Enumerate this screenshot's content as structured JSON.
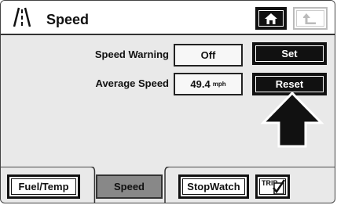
{
  "header": {
    "title": "Speed",
    "app_icon": "road-icon",
    "home_icon": "home-icon",
    "back_icon": "back-arrow-icon"
  },
  "rows": {
    "speed_warning": {
      "label": "Speed Warning",
      "value": "Off",
      "button": "Set"
    },
    "average_speed": {
      "label": "Average Speed",
      "value": "49.4",
      "unit": "mph",
      "button": "Reset"
    }
  },
  "tabs": [
    {
      "label": "Fuel/Temp"
    },
    {
      "label": "Speed"
    },
    {
      "label": "StopWatch"
    },
    {
      "label": "TRIP",
      "icon": "trip-checklist-icon"
    }
  ],
  "colors": {
    "active_tab": "#888888",
    "button": "#111111",
    "background": "#e9e9e9"
  }
}
